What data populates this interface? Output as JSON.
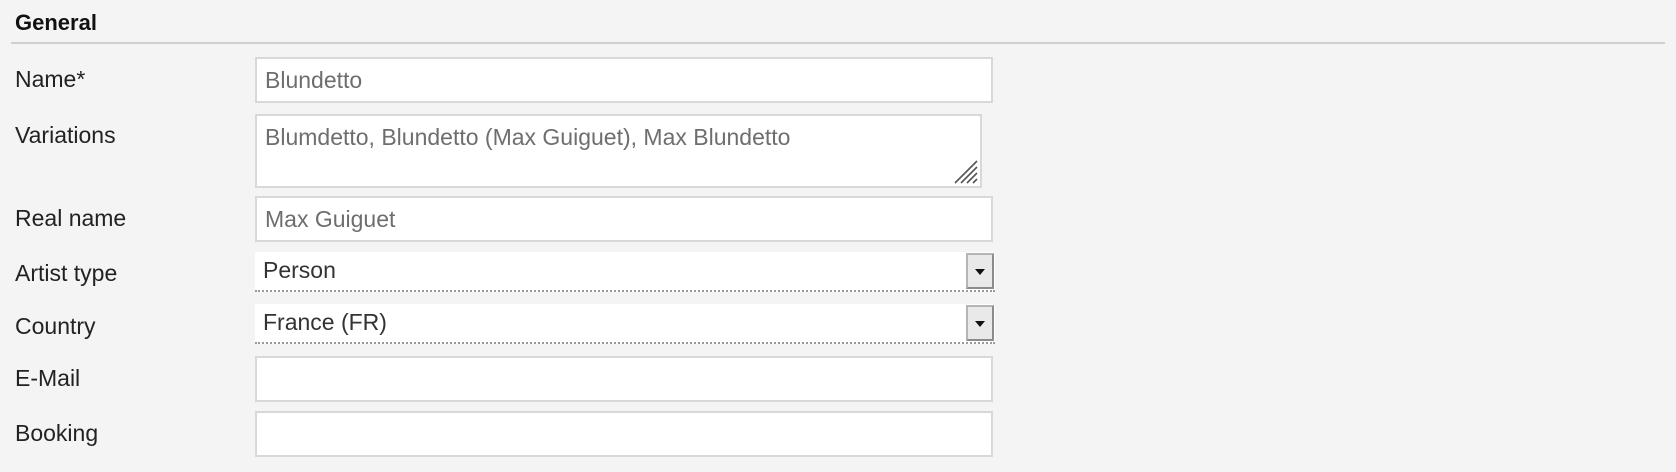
{
  "section": {
    "title": "General"
  },
  "fields": {
    "name": {
      "label": "Name*",
      "value": "Blundetto"
    },
    "variations": {
      "label": "Variations",
      "value": "Blumdetto, Blundetto (Max Guiguet), Max Blundetto"
    },
    "real_name": {
      "label": "Real name",
      "value": "Max Guiguet"
    },
    "artist_type": {
      "label": "Artist type",
      "selected": "Person"
    },
    "country": {
      "label": "Country",
      "selected": "France (FR)"
    },
    "email": {
      "label": "E-Mail",
      "value": ""
    },
    "booking": {
      "label": "Booking",
      "value": ""
    }
  },
  "icons": {
    "dropdown": "chevron-down-icon",
    "resize": "resize-grip-icon"
  },
  "colors": {
    "background": "#f4f4f4",
    "input_border": "#d8d8d8",
    "input_text": "#6e6e6e",
    "rule": "#cfcfcf"
  }
}
